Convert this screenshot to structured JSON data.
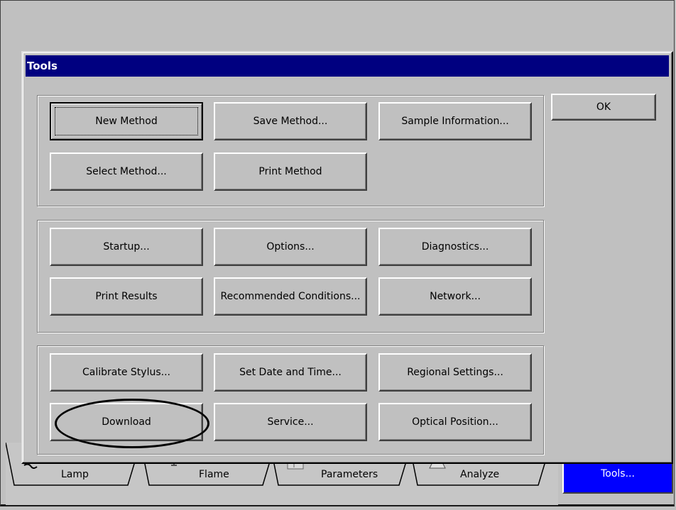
{
  "dialog": {
    "title": "Tools",
    "ok_label": "OK"
  },
  "groups": {
    "method": {
      "new_method": "New Method",
      "save_method": "Save Method...",
      "sample_information": "Sample Information...",
      "select_method": "Select Method...",
      "print_method": "Print Method"
    },
    "instrument": {
      "startup": "Startup...",
      "options": "Options...",
      "diagnostics": "Diagnostics...",
      "print_results": "Print Results",
      "recommended_conditions": "Recommended Conditions...",
      "network": "Network..."
    },
    "system": {
      "calibrate_stylus": "Calibrate Stylus...",
      "set_date_time": "Set Date and Time...",
      "regional_settings": "Regional Settings...",
      "download": "Download",
      "service": "Service...",
      "optical_position": "Optical Position..."
    }
  },
  "tabs": {
    "lamp": "Lamp",
    "flame": "Flame",
    "parameters": "Parameters",
    "analyze": "Analyze",
    "tools": "Tools..."
  },
  "colors": {
    "titlebar": "#000080",
    "active_tab": "#0000ff",
    "face": "#c0c0c0"
  }
}
